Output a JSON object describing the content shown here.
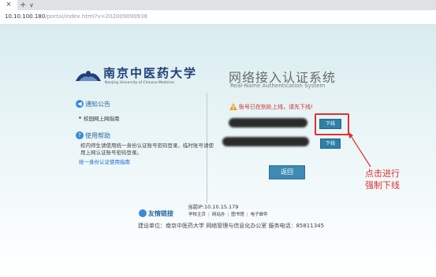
{
  "browser": {
    "tab_close": "×",
    "tab_add": "+",
    "tab_menu": "∨",
    "url_host": "10.10.100.180",
    "url_path": "/portal/index.html?v=202009090938"
  },
  "logo": {
    "name_cn": "南京中医药大学",
    "name_en": "Nanjing University of Chinese Medicine"
  },
  "system": {
    "title_cn": "网络接入认证系统",
    "title_en": "Real-Name Authentication System"
  },
  "notice": {
    "title": "通知公告",
    "items": [
      "校园网上网指南"
    ]
  },
  "help": {
    "title": "使用帮助",
    "text": "校内师生请使用统一身份认证账号密码登录，临时账号请使用上网认证账号密码登录。",
    "link": "统一身份认证使用指南"
  },
  "status": {
    "warning": "账号已在别处上线，请先下线!",
    "offline_btn_1": "下线",
    "offline_btn_2": "下线",
    "back_btn": "返回"
  },
  "annotation": {
    "line1": "点击进行",
    "line2": "强制下线",
    "color": "#e03030"
  },
  "footer": {
    "ip": "当前IP:10.10.15.179",
    "friend_title": "友情链接",
    "links": [
      "学校主页",
      "网站办",
      "图书馆",
      "电子邮件"
    ],
    "builder": "建设单位：南京中医药大学 网络管理与信息化办公室 服务电话：85811345"
  },
  "colors": {
    "accent": "#2f7fa6",
    "warning": "#d12a2a"
  }
}
